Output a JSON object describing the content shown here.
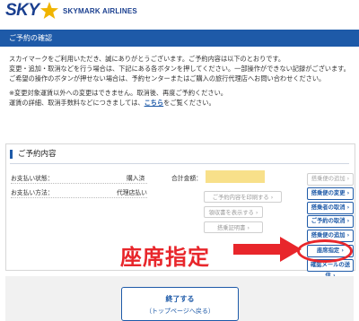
{
  "brand": {
    "logo_sky": "SKY",
    "logo_name": "SKYMARK AIRLINES",
    "color": "#1a3f8f"
  },
  "title_bar": {
    "text": "ご予約の確認",
    "color": "#1e5aa8"
  },
  "intro": {
    "line1": "スカイマークをご利用いただき、誠にありがとうございます。ご予約内容は以下のとおりです。",
    "line2": "変更・追加・取消などを行う場合は、下記にある各ボタンを押してください。一部操作ができない記録がございます。",
    "line3": "ご希望の操作のボタンが押せない場合は、予約センターまたはご購入の旅行代理店へお問い合わせください。",
    "note1": "※変更対象運賃以外への変更はできません。取消後、再度ご予約ください。",
    "note2_before": "運賃の詳細、取消手数料などにつきましては、",
    "note2_link": "こちら",
    "note2_after": "をご覧ください。"
  },
  "panel": {
    "title": "ご予約内容",
    "payment_status_label": "お支払い状態：",
    "payment_status_value": "購入済",
    "payment_method_label": "お支払い方法：",
    "payment_method_value": "代理店払い",
    "total_label": "合計金額："
  },
  "buttons": {
    "print": "ご予約内容を印刷する",
    "receipt": "領収書を表示する",
    "boarding": "搭乗証明書",
    "add_passenger": "搭乗便の追加",
    "change_flight": "搭乗便の変更",
    "cancel_passenger": "搭乗者の取消",
    "cancel_booking": "ご予約の取消",
    "seat": "座席指定",
    "resend_email": "確認メールの送信"
  },
  "annotation": {
    "label": "座席指定",
    "color": "#e8262b"
  },
  "footer": {
    "finish_label": "終了する",
    "finish_sub": "（トップページへ戻る）"
  }
}
